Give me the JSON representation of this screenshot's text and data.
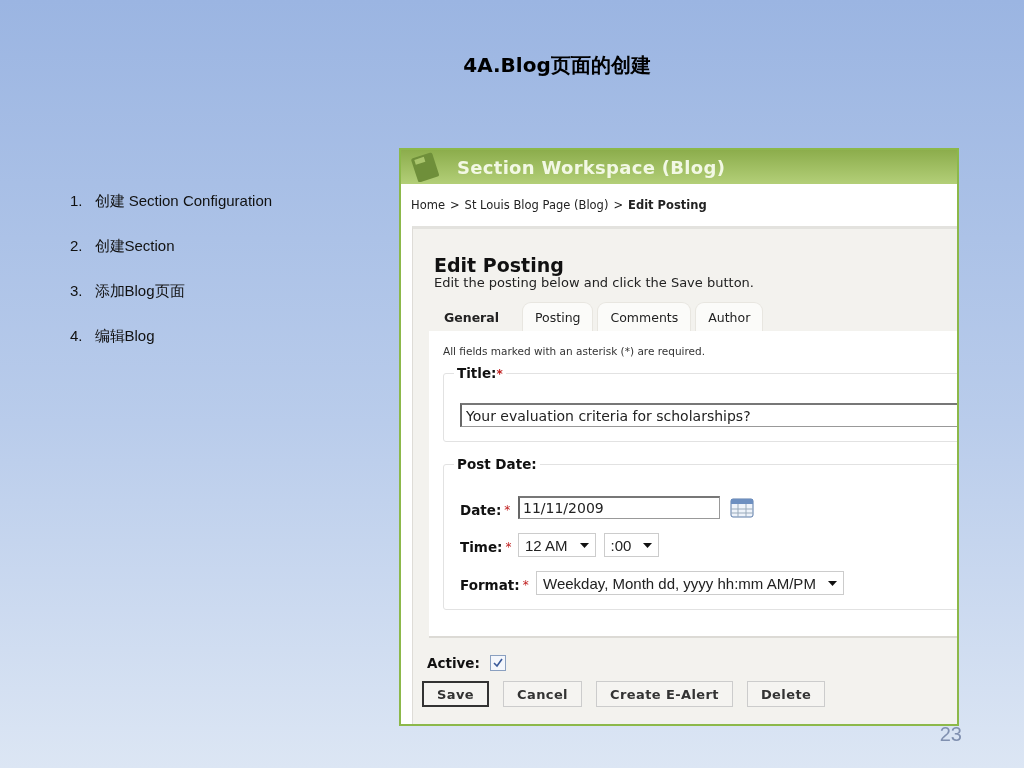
{
  "slide": {
    "title": "4A.Blog页面的创建",
    "page_number": "23"
  },
  "steps": [
    {
      "number": "1.",
      "text": "创建 Section Configuration"
    },
    {
      "number": "2.",
      "text": "创建Section"
    },
    {
      "number": "3.",
      "text": "添加Blog页面"
    },
    {
      "number": "4.",
      "text": "编辑Blog"
    }
  ],
  "screenshot": {
    "header": {
      "title": "Section Workspace (Blog)"
    },
    "breadcrumb": [
      {
        "label": "Home",
        "current": false
      },
      {
        "label": ">",
        "current": false
      },
      {
        "label": "St Louis Blog Page (Blog)",
        "current": false
      },
      {
        "label": ">",
        "current": false
      },
      {
        "label": "Edit Posting",
        "current": true
      }
    ],
    "heading": "Edit Posting",
    "subheading": "Edit the posting below and click the Save button.",
    "tabs": [
      {
        "label": "General",
        "selected": true
      },
      {
        "label": "Posting",
        "selected": false
      },
      {
        "label": "Comments",
        "selected": false
      },
      {
        "label": "Author",
        "selected": false
      }
    ],
    "note": "All fields marked with an asterisk (*) are required.",
    "title_group": {
      "legend": "Title:",
      "mark": "*",
      "value": "Your evaluation criteria for scholarships?"
    },
    "post_date": {
      "legend": "Post Date:",
      "fields": [
        {
          "kind": "date",
          "label": "Date:",
          "mark": "*",
          "value": "11/11/2009"
        },
        {
          "kind": "selects",
          "label": "Time:",
          "mark": "*",
          "options": [
            "12 AM",
            ":00"
          ]
        },
        {
          "kind": "selects",
          "label": "Format:",
          "mark": "*",
          "options": [
            "Weekday, Month dd, yyyy hh:mm AM/PM"
          ]
        }
      ]
    },
    "active": {
      "label": "Active:",
      "checked": true
    },
    "buttons": [
      {
        "label": "Save",
        "default": true
      },
      {
        "label": "Cancel",
        "default": false
      },
      {
        "label": "Create E-Alert",
        "default": false
      },
      {
        "label": "Delete",
        "default": false
      }
    ]
  }
}
